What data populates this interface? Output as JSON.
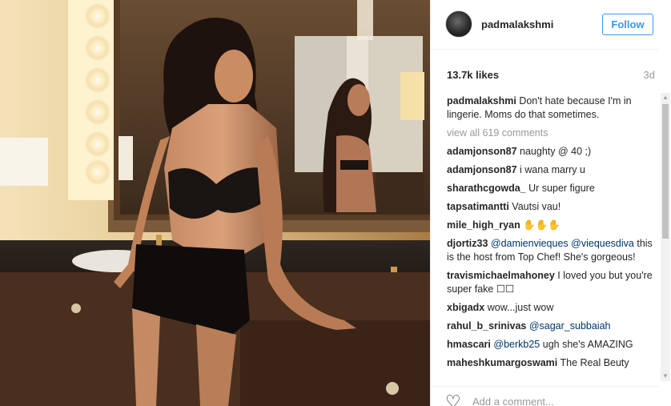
{
  "post": {
    "username": "padmalakshmi",
    "follow_label": "Follow",
    "likes": "13.7k likes",
    "time": "3d",
    "caption_user": "padmalakshmi",
    "caption_text": "Don't hate because I'm in lingerie. Moms do that sometimes.",
    "view_all": "view all 619 comments",
    "add_comment_placeholder": "Add a comment..."
  },
  "comments": [
    {
      "user": "adamjonson87",
      "text": "naughty @ 40 ;)"
    },
    {
      "user": "adamjonson87",
      "text": "i wana marry u"
    },
    {
      "user": "sharathcgowda_",
      "text": "Ur super figure"
    },
    {
      "user": "tapsatimantti",
      "text": "Vautsi vau!"
    },
    {
      "user": "mile_high_ryan",
      "text": "✋✋✋"
    },
    {
      "user": "djortiz33",
      "mention1": "@damienvieques",
      "mention2": "@viequesdiva",
      "text": "this is the host from Top Chef! She's gorgeous!"
    },
    {
      "user": "travismichaelmahoney",
      "text": "I loved you but you're super fake ☐☐"
    },
    {
      "user": "xbigadx",
      "text": "wow...just wow"
    },
    {
      "user": "rahul_b_srinivas",
      "mention1": "@sagar_subbaiah"
    },
    {
      "user": "hmascari",
      "mention1": "@berkb25",
      "text": "ugh she's AMAZING"
    },
    {
      "user": "maheshkumargoswami",
      "text": "The Real Beuty"
    }
  ],
  "colors": {
    "accent": "#3897f0",
    "mention": "#003569",
    "muted": "#999999"
  },
  "icons": {
    "heart": "heart-outline-icon"
  }
}
